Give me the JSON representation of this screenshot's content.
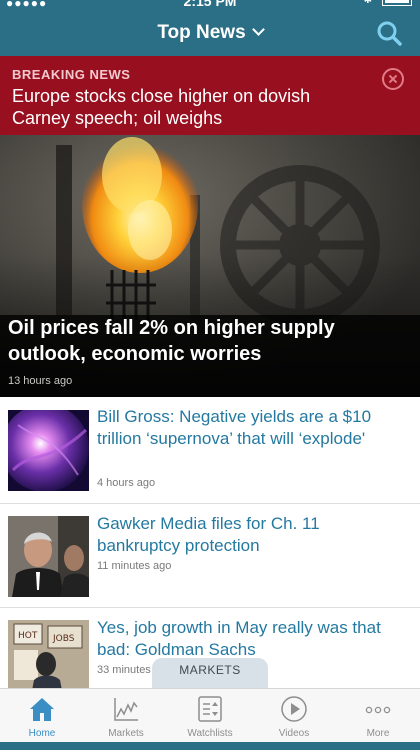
{
  "status_bar": {
    "time": "2:15 PM",
    "signal": "●●●●●"
  },
  "header": {
    "title": "Top News"
  },
  "breaking": {
    "label": "BREAKING NEWS",
    "headline": "Europe stocks close higher on dovish Carney speech; oil weighs"
  },
  "hero": {
    "title": "Oil prices fall 2% on higher supply outlook, economic worries",
    "time_ago": "13 hours ago"
  },
  "articles": [
    {
      "headline": "Bill Gross: Negative yields are a $10 trillion ‘supernova’ that will ‘explode'",
      "time_ago": "4 hours ago"
    },
    {
      "headline": "Gawker Media files for Ch. 11 bankruptcy protection",
      "time_ago": "11 minutes ago"
    },
    {
      "headline": "Yes, job growth in May really was that bad: Goldman Sachs",
      "time_ago": "33 minutes ago"
    }
  ],
  "markets_tab": {
    "label": "MARKETS"
  },
  "tabbar": {
    "items": [
      {
        "label": "Home",
        "icon": "home-icon",
        "active": true
      },
      {
        "label": "Markets",
        "icon": "markets-chart-icon",
        "active": false
      },
      {
        "label": "Watchlists",
        "icon": "watchlists-icon",
        "active": false
      },
      {
        "label": "Videos",
        "icon": "play-icon",
        "active": false
      },
      {
        "label": "More",
        "icon": "more-dots-icon",
        "active": false
      }
    ]
  },
  "colors": {
    "header": "#2a6f86",
    "breaking": "#98101f",
    "link": "#2479a0",
    "tab_active": "#3b8ec4"
  }
}
